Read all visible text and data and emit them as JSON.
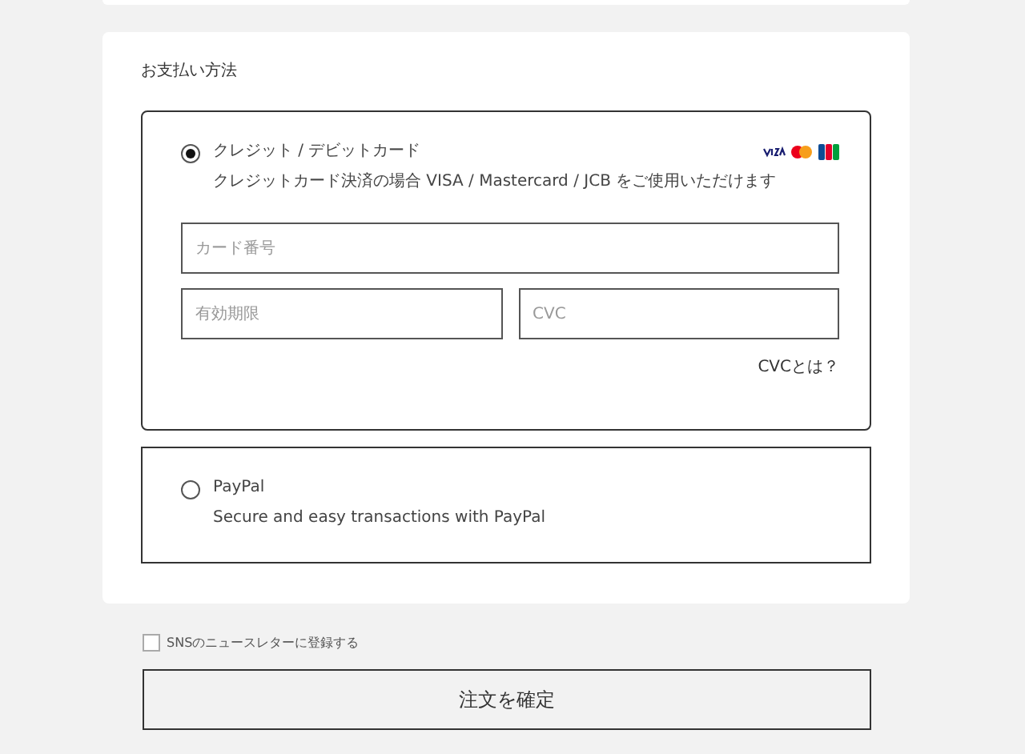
{
  "section_title": "お支払い方法",
  "payment_methods": [
    {
      "kind": "card",
      "label": "クレジット / デビットカード",
      "description": "クレジットカード決済の場合 VISA / Mastercard / JCB をご使用いただけます",
      "selected": true,
      "fields": {
        "card_number": {
          "placeholder": "カード番号"
        },
        "expiry": {
          "placeholder": "有効期限"
        },
        "cvc": {
          "placeholder": "CVC"
        }
      },
      "cvc_help_link": "CVCとは？"
    },
    {
      "kind": "paypal",
      "label": "PayPal",
      "description": "Secure and easy transactions with PayPal",
      "selected": false
    }
  ],
  "newsletter": {
    "label": "SNSのニュースレターに登録する",
    "checked": false
  },
  "confirm_button": "注文を確定"
}
